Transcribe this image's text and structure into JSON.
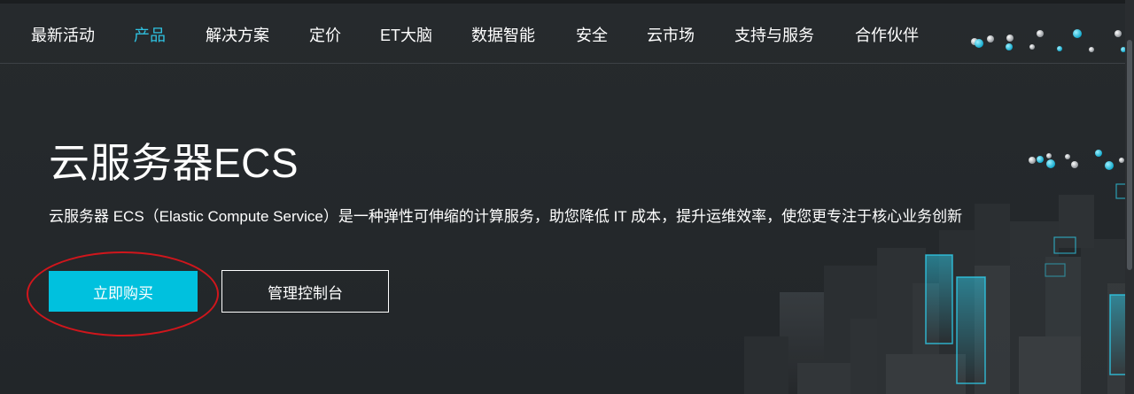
{
  "nav": {
    "items": [
      {
        "label": "最新活动"
      },
      {
        "label": "产品"
      },
      {
        "label": "解决方案"
      },
      {
        "label": "定价"
      },
      {
        "label": "ET大脑"
      },
      {
        "label": "数据智能"
      },
      {
        "label": "安全"
      },
      {
        "label": "云市场"
      },
      {
        "label": "支持与服务"
      },
      {
        "label": "合作伙伴"
      }
    ],
    "active_label": "产品"
  },
  "hero": {
    "title": "云服务器ECS",
    "description": "云服务器 ECS（Elastic Compute Service）是一种弹性可伸缩的计算服务，助您降低 IT 成本，提升运维效率，使您更专注于核心业务创新",
    "buy_button": "立即购买",
    "console_button": "管理控制台"
  },
  "colors": {
    "accent": "#00c1de",
    "active_nav": "#2fc1e0",
    "annotation": "#d0161c",
    "background": "#24272a"
  }
}
